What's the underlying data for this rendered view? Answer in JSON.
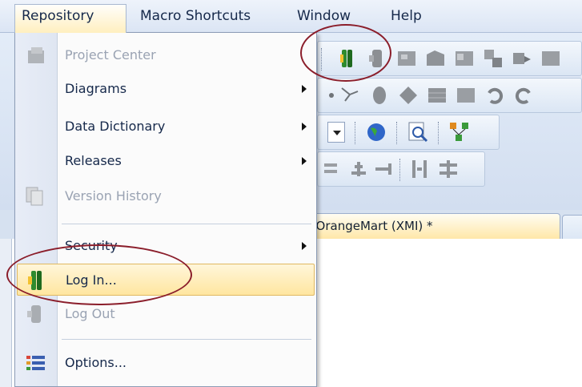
{
  "menubar": {
    "items": [
      {
        "label": "Repository",
        "active": true
      },
      {
        "label": "Macro Shortcuts"
      },
      {
        "label": "Window"
      },
      {
        "label": "Help"
      }
    ]
  },
  "dropdown": {
    "items": [
      {
        "label": "Project Center",
        "disabled": true,
        "icon": "project-center-icon"
      },
      {
        "label": "Diagrams",
        "submenu": true
      },
      {
        "label": "Data Dictionary",
        "submenu": true
      },
      {
        "label": "Releases",
        "submenu": true
      },
      {
        "label": "Version History",
        "disabled": true,
        "icon": "version-history-icon"
      },
      {
        "label": "Security",
        "submenu": true
      },
      {
        "label": "Log In...",
        "highlighted": true,
        "icon": "login-icon"
      },
      {
        "label": "Log Out",
        "disabled": true,
        "icon": "logout-icon"
      },
      {
        "label": "Options...",
        "icon": "options-icon"
      }
    ]
  },
  "document_tab": {
    "label": "l View: OrangeMart (XMI) *"
  },
  "colors": {
    "annotation": "#8b1e2b",
    "highlight": "#ffe6a0",
    "login_icon": "#2e8b2e"
  }
}
